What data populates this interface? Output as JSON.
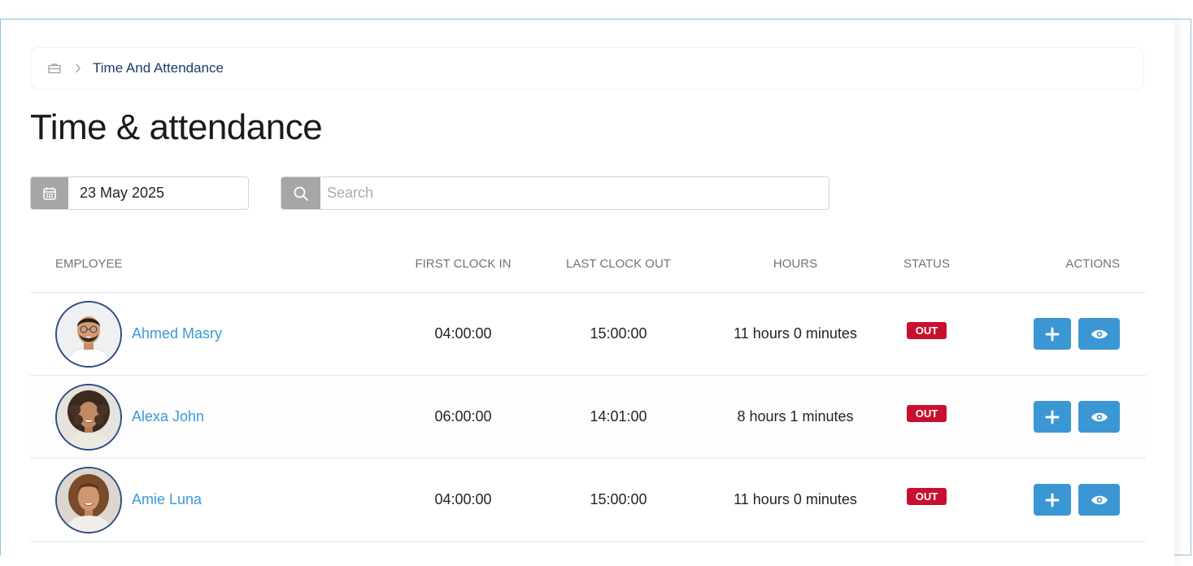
{
  "breadcrumb": {
    "home_icon": "briefcase-icon",
    "separator_icon": "chevron-right-icon",
    "current": "Time And Attendance"
  },
  "page": {
    "title": "Time & attendance"
  },
  "filters": {
    "date_icon": "calendar-icon",
    "date_value": "23 May 2025",
    "search_icon": "search-icon",
    "search_placeholder": "Search",
    "search_value": ""
  },
  "table": {
    "columns": [
      "EMPLOYEE",
      "FIRST CLOCK IN",
      "LAST CLOCK OUT",
      "HOURS",
      "STATUS",
      "ACTIONS"
    ],
    "rows": [
      {
        "name": "Ahmed Masry",
        "first_clock_in": "04:00:00",
        "last_clock_out": "15:00:00",
        "hours": "11 hours 0 minutes",
        "status": "OUT"
      },
      {
        "name": "Alexa John",
        "first_clock_in": "06:00:00",
        "last_clock_out": "14:01:00",
        "hours": "8 hours 1 minutes",
        "status": "OUT"
      },
      {
        "name": "Amie Luna",
        "first_clock_in": "04:00:00",
        "last_clock_out": "15:00:00",
        "hours": "11 hours 0 minutes",
        "status": "OUT"
      }
    ],
    "action_icons": [
      "plus-icon",
      "eye-icon"
    ]
  },
  "colors": {
    "accent": "#3b97d3",
    "status_out": "#c8102e",
    "name_link": "#3a9ad9",
    "breadcrumb_text": "#1c3d6b",
    "addon_bg": "#a6a6a6"
  }
}
